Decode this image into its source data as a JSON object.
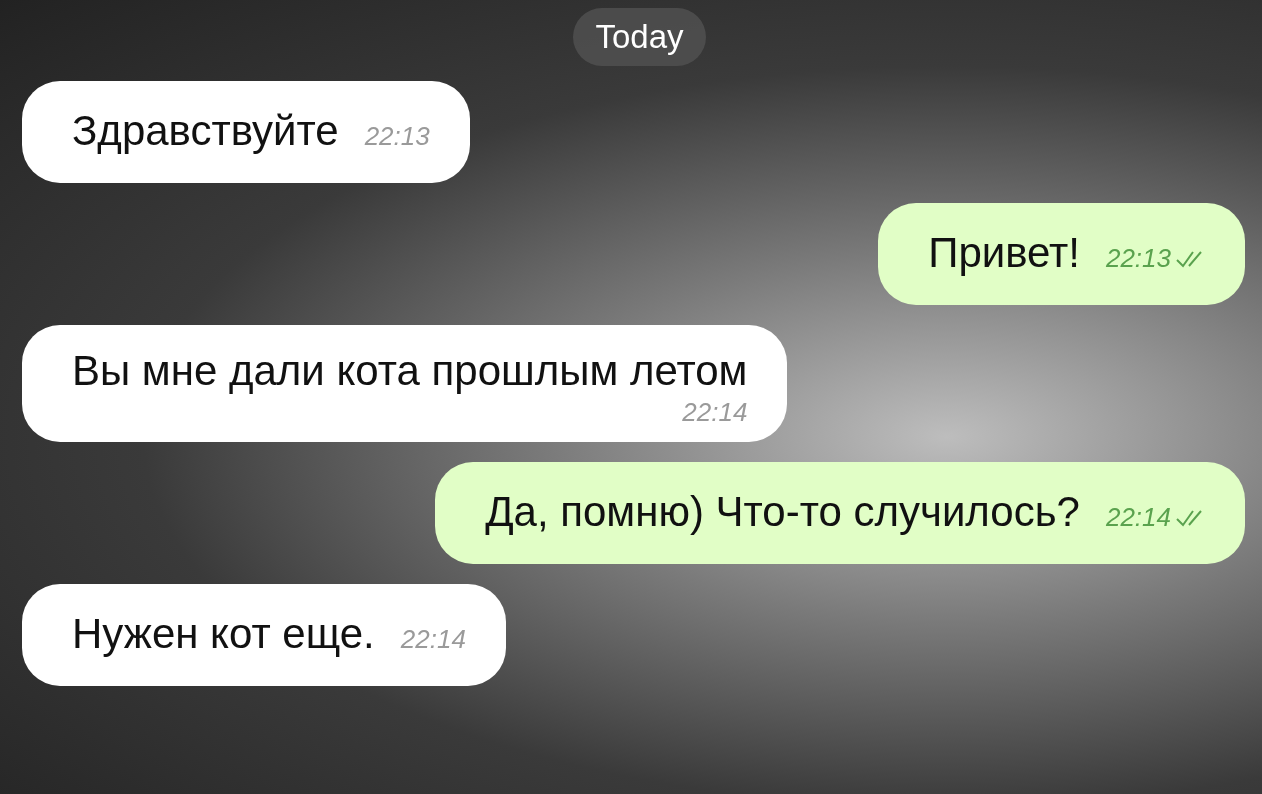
{
  "date_pill": "Today",
  "messages": [
    {
      "outgoing": false,
      "text": "Здравствуйте",
      "time": "22:13",
      "time_below": false
    },
    {
      "outgoing": true,
      "text": "Привет!",
      "time": "22:13",
      "time_below": false,
      "read": true
    },
    {
      "outgoing": false,
      "text": "Вы мне дали кота прошлым летом",
      "time": "22:14",
      "time_below": true
    },
    {
      "outgoing": true,
      "text": "Да, помню) Что-то случилось?",
      "time": "22:14",
      "time_below": false,
      "read": true
    },
    {
      "outgoing": false,
      "text": "Нужен кот еще.",
      "time": "22:14",
      "time_below": false
    }
  ]
}
